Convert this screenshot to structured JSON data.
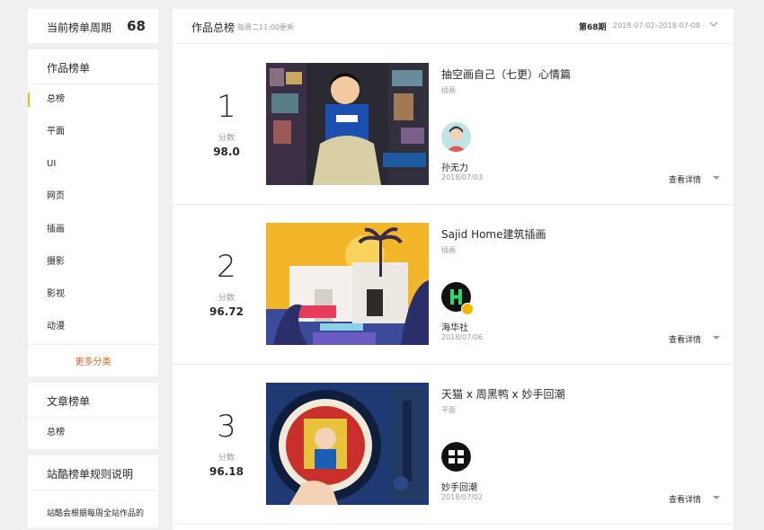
{
  "sidebar": {
    "cycle_label": "当前榜单周期",
    "cycle_value": "68",
    "works_title": "作品榜单",
    "categories": [
      "总榜",
      "平面",
      "UI",
      "网页",
      "插画",
      "摄影",
      "影视",
      "动漫"
    ],
    "more_label": "更多分类",
    "articles_title": "文章榜单",
    "articles_item": "总榜",
    "rules_title": "站酷榜单规则说明",
    "rules_desc": "站酷会根据每周全站作品的"
  },
  "main": {
    "title": "作品总榜",
    "update_note": "每周二11:00更新",
    "period": "第68期",
    "range": "2018-07-02–2018-07-08",
    "score_label": "分数",
    "details_label": "查看详情",
    "entries": [
      {
        "rank": "1",
        "score": "98.0",
        "title": "抽空画自己（七更）心情篇",
        "type": "插画",
        "author": "孙无力",
        "date": "2018/07/03"
      },
      {
        "rank": "2",
        "score": "96.72",
        "title": "Sajid Home建筑插画",
        "type": "插画",
        "author": "海华社",
        "date": "2018/07/06"
      },
      {
        "rank": "3",
        "score": "96.18",
        "title": "天猫 x 周黑鸭 x 妙手回潮",
        "type": "平面",
        "author": "妙手回潮",
        "date": "2018/07/02"
      }
    ]
  },
  "icons": {
    "chevron": "chevron-down-icon",
    "caret": "caret-down-icon",
    "verified": "verified-badge-icon"
  },
  "colors": {
    "accent": "#f5b500",
    "more_link": "#e0661a",
    "muted": "#999999"
  }
}
